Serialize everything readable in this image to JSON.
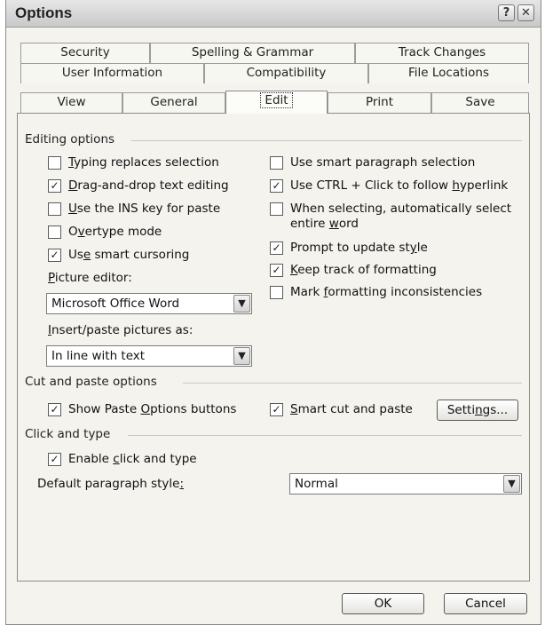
{
  "window": {
    "title": "Options",
    "help_glyph": "?",
    "close_glyph": "✕"
  },
  "tabs": {
    "row1": [
      "Security",
      "Spelling & Grammar",
      "Track Changes"
    ],
    "row2": [
      "User Information",
      "Compatibility",
      "File Locations"
    ],
    "row3": [
      "View",
      "General",
      "Edit",
      "Print",
      "Save"
    ],
    "active": "Edit"
  },
  "editing_options": {
    "heading": "Editing options",
    "left": [
      {
        "pre": "",
        "u": "T",
        "post": "yping replaces selection",
        "checked": false
      },
      {
        "pre": "",
        "u": "D",
        "post": "rag-and-drop text editing",
        "checked": true
      },
      {
        "pre": "",
        "u": "U",
        "post": "se the INS key for paste",
        "checked": false
      },
      {
        "pre": "O",
        "u": "v",
        "post": "ertype mode",
        "checked": false
      },
      {
        "pre": "Us",
        "u": "e",
        "post": " smart cursoring",
        "checked": true
      }
    ],
    "right": [
      {
        "pre": "Use smart para",
        "u": "g",
        "post": "raph selection",
        "line2": "",
        "checked": false
      },
      {
        "pre": "Use CTRL + Click to follow ",
        "u": "h",
        "post": "yperlink",
        "line2": "",
        "checked": true
      },
      {
        "pre": "When selecting, automatically select",
        "u": "",
        "post": "",
        "line2_pre": "entire ",
        "line2_u": "w",
        "line2_post": "ord",
        "checked": false
      },
      {
        "pre": "Prompt to update st",
        "u": "y",
        "post": "le",
        "line2": "",
        "checked": true
      },
      {
        "pre": "",
        "u": "K",
        "post": "eep track of formatting",
        "line2": "",
        "checked": true
      },
      {
        "pre": "Mark ",
        "u": "f",
        "post": "ormatting inconsistencies",
        "line2": "",
        "checked": false
      }
    ],
    "picture_editor_label_u": "P",
    "picture_editor_label_rest": "icture editor:",
    "picture_editor_value": "Microsoft Office Word",
    "insert_label_u": "I",
    "insert_label_rest": "nsert/paste pictures as:",
    "insert_value": "In line with text"
  },
  "cut_paste": {
    "heading": "Cut and paste options",
    "show_paste": {
      "pre": "Show Paste ",
      "u": "O",
      "post": "ptions buttons",
      "checked": true
    },
    "smart_cut": {
      "pre": "",
      "u": "S",
      "post": "mart cut and paste",
      "checked": true
    },
    "settings_pre": "Setti",
    "settings_u": "n",
    "settings_post": "gs..."
  },
  "click_type": {
    "heading": "Click and type",
    "enable": {
      "pre": "Enable ",
      "u": "c",
      "post": "lick and type",
      "checked": true
    },
    "default_style_label_pre": "Default paragraph style",
    "default_style_label_u": ":",
    "default_style_value": "Normal"
  },
  "footer": {
    "ok": "OK",
    "cancel": "Cancel"
  },
  "check_glyph": "✓",
  "arrow_glyph": "▼"
}
